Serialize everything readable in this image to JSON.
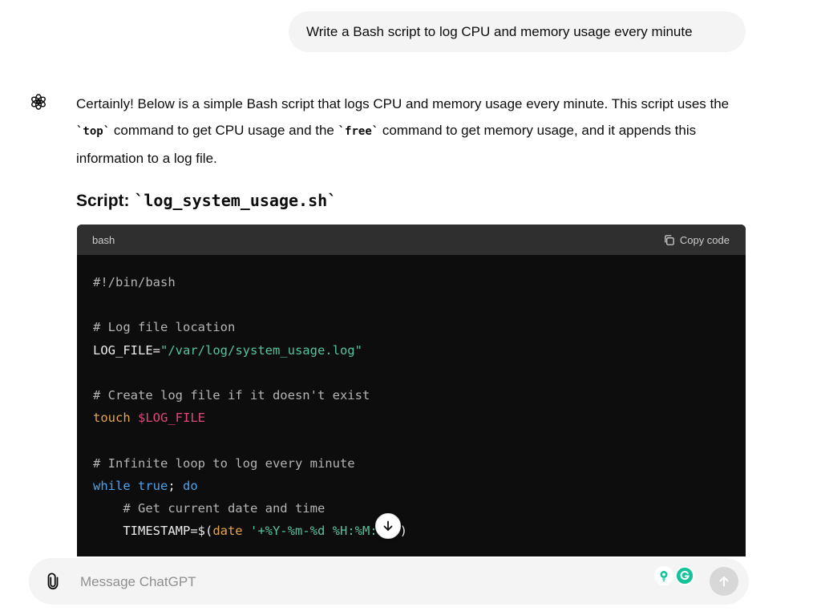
{
  "user_message": "Write a Bash script to log CPU and memory usage every minute",
  "assistant": {
    "intro_part1": "Certainly! Below is a simple Bash script that logs CPU and memory usage every minute. This script uses the ",
    "code_top": "`top`",
    "intro_part2": " command to get CPU usage and the ",
    "code_free": "`free`",
    "intro_part3": " command to get memory usage, and it appends this information to a log file.",
    "heading_label": "Script: ",
    "heading_filename": "`log_system_usage.sh`"
  },
  "code_block": {
    "language": "bash",
    "copy_label": "Copy code",
    "lines": {
      "l1": "#!/bin/bash",
      "l3": "# Log file location",
      "l4_var": "LOG_FILE=",
      "l4_str": "\"/var/log/system_usage.log\"",
      "l6": "# Create log file if it doesn't exist",
      "l7_kw": "touch",
      "l7_var": "$LOG_FILE",
      "l9": "# Infinite loop to log every minute",
      "l10_while": "while",
      "l10_true": "true",
      "l10_semi": ";",
      "l10_do": "do",
      "l11": "    # Get current date and time",
      "l12_a": "    TIMESTAMP=$(",
      "l12_kw": "date",
      "l12_str": "'+%Y-%m-%d %H:%M:%S'",
      "l12_b": ")"
    }
  },
  "composer": {
    "placeholder": "Message ChatGPT"
  },
  "colors": {
    "user_bubble": "#f4f4f4",
    "code_bg": "#0d0d0d",
    "code_header_bg": "#2f2f2f",
    "string": "#55c49f",
    "keyword": "#e8a44b",
    "variable": "#e4457a",
    "builtin": "#4aa3f0",
    "grammarly": "#15c39a",
    "send_disabled": "#d7d7d7"
  },
  "icons": {
    "assistant": "openai-logo-icon",
    "copy": "copy-icon",
    "scroll": "arrow-down-icon",
    "attach": "paperclip-icon",
    "ext1": "lightbulb-icon",
    "ext2": "grammarly-icon",
    "send": "arrow-up-icon"
  }
}
